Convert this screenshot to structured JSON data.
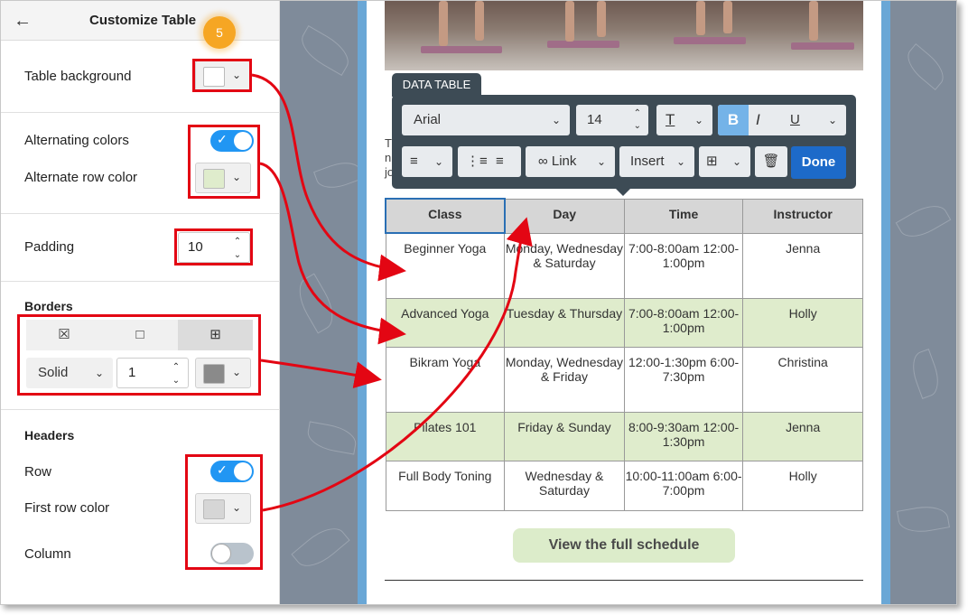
{
  "panel": {
    "title": "Customize Table",
    "step_badge": "5",
    "table_background": {
      "label": "Table background",
      "swatch": "#ffffff"
    },
    "alternating": {
      "label": "Alternating colors",
      "on": true
    },
    "alternate_row": {
      "label": "Alternate row color",
      "swatch": "#dfeccc"
    },
    "padding": {
      "label": "Padding",
      "value": "10"
    },
    "borders": {
      "label": "Borders",
      "style": "Solid",
      "width": "1",
      "swatch": "#8a8a8a"
    },
    "headers": {
      "label": "Headers",
      "row_label": "Row",
      "row_on": true,
      "first_row_label": "First row color",
      "first_row_swatch": "#d6d6d6",
      "column_label": "Column",
      "column_on": false
    }
  },
  "toolbar": {
    "tab": "DATA TABLE",
    "font": "Arial",
    "size": "14",
    "bold": "B",
    "italic": "I",
    "underline": "U",
    "link": "Link",
    "insert": "Insert",
    "done": "Done"
  },
  "content": {
    "title_fragment": "...",
    "text_fragment": [
      "T",
      "n",
      "jo"
    ],
    "table": {
      "headers": [
        "Class",
        "Day",
        "Time",
        "Instructor"
      ],
      "rows": [
        [
          "Beginner Yoga",
          "Monday, Wednesday & Saturday",
          "7:00-8:00am 12:00-1:00pm",
          "Jenna"
        ],
        [
          "Advanced Yoga",
          "Tuesday & Thursday",
          "7:00-8:00am 12:00-1:00pm",
          "Holly"
        ],
        [
          "Bikram Yoga",
          "Monday, Wednesday & Friday",
          "12:00-1:30pm 6:00-7:30pm",
          "Christina"
        ],
        [
          "Pilates 101",
          "Friday & Sunday",
          "8:00-9:30am 12:00-1:30pm",
          "Jenna"
        ],
        [
          "Full Body Toning",
          "Wednesday & Saturday",
          "10:00-11:00am 6:00-7:00pm",
          "Holly"
        ]
      ]
    },
    "button": "View the full schedule"
  },
  "colors": {
    "accent": "#2196f3",
    "done": "#1d6ac9",
    "alt_row": "#dfeccc",
    "header_row": "#d6d6d6",
    "annotation": "#e30613",
    "badge": "#f6a623"
  }
}
